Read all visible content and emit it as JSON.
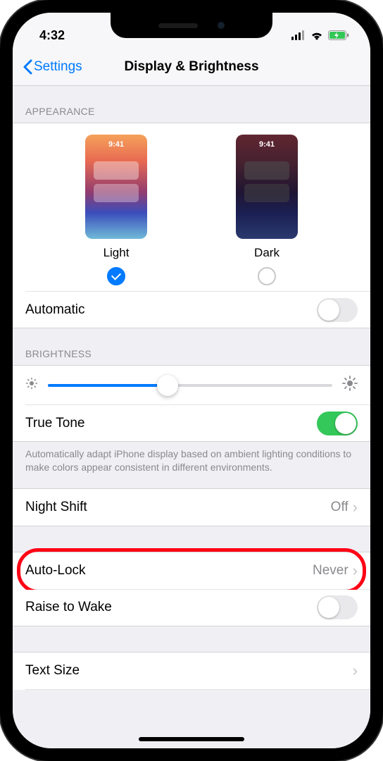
{
  "status": {
    "time": "4:32"
  },
  "nav": {
    "back": "Settings",
    "title": "Display & Brightness"
  },
  "appearance": {
    "header": "APPEARANCE",
    "thumb_time": "9:41",
    "light_label": "Light",
    "dark_label": "Dark",
    "selected": "light",
    "automatic_label": "Automatic",
    "automatic_on": false
  },
  "brightness": {
    "header": "BRIGHTNESS",
    "level_percent": 42,
    "true_tone_label": "True Tone",
    "true_tone_on": true,
    "footer": "Automatically adapt iPhone display based on ambient lighting conditions to make colors appear consistent in different environments."
  },
  "night_shift": {
    "label": "Night Shift",
    "value": "Off"
  },
  "auto_lock": {
    "label": "Auto-Lock",
    "value": "Never"
  },
  "raise_to_wake": {
    "label": "Raise to Wake",
    "on": false
  },
  "text_size": {
    "label": "Text Size"
  }
}
